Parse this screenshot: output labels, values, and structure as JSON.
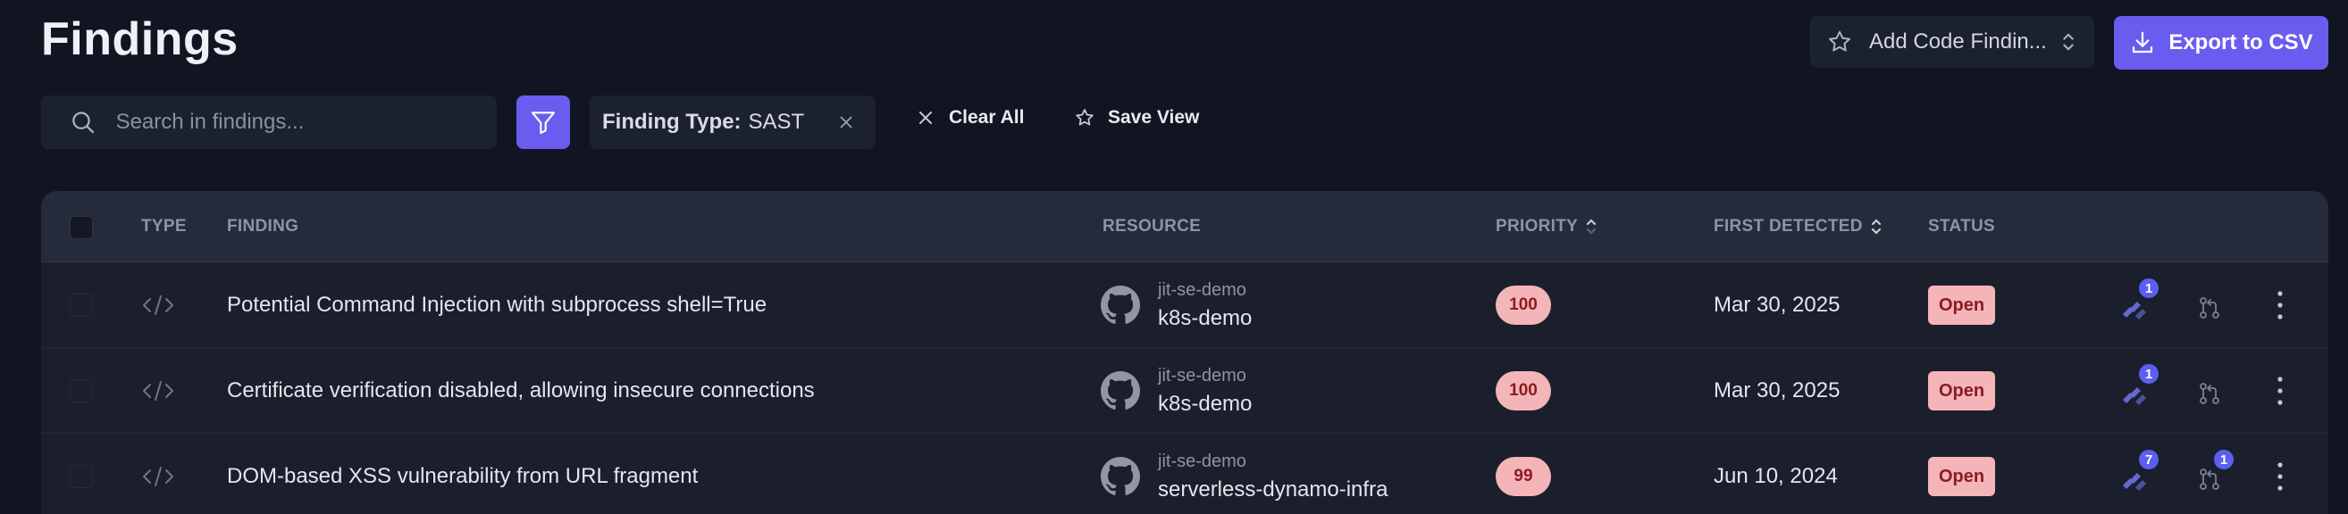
{
  "header": {
    "title": "Findings",
    "view_select_label": "Add Code Findin...",
    "export_label": "Export to CSV"
  },
  "toolbar": {
    "search_placeholder": "Search in findings...",
    "filter_chip": {
      "key": "Finding Type:",
      "value": "SAST"
    },
    "clear_all_label": "Clear All",
    "save_view_label": "Save View"
  },
  "table": {
    "columns": {
      "type": "TYPE",
      "finding": "FINDING",
      "resource": "RESOURCE",
      "priority": "PRIORITY",
      "first_detected": "FIRST DETECTED",
      "status": "STATUS"
    },
    "rows": [
      {
        "finding": "Potential Command Injection with subprocess shell=True",
        "org": "jit-se-demo",
        "repo": "k8s-demo",
        "priority": "100",
        "first_detected": "Mar 30, 2025",
        "status": "Open",
        "jira_count": "1",
        "pr_count": ""
      },
      {
        "finding": "Certificate verification disabled, allowing insecure connections",
        "org": "jit-se-demo",
        "repo": "k8s-demo",
        "priority": "100",
        "first_detected": "Mar 30, 2025",
        "status": "Open",
        "jira_count": "1",
        "pr_count": ""
      },
      {
        "finding": "DOM-based XSS vulnerability from URL fragment",
        "org": "jit-se-demo",
        "repo": "serverless-dynamo-infra",
        "priority": "99",
        "first_detected": "Jun 10, 2024",
        "status": "Open",
        "jira_count": "7",
        "pr_count": "1"
      }
    ]
  },
  "colors": {
    "background": "#111522",
    "accent": "#6b5cf0",
    "badge_bg": "#f3b5b8",
    "badge_text": "#8d1a22"
  },
  "icons": {
    "view_select": "star-icon",
    "export": "download-icon",
    "search": "search-icon",
    "filter": "funnel-icon",
    "chip_remove": "close-icon",
    "clear_all": "close-icon",
    "save_view": "star-icon",
    "type": "code-icon",
    "resource": "github-icon",
    "jira": "jira-icon",
    "pr": "git-pull-request-icon",
    "more": "kebab-menu-icon"
  }
}
